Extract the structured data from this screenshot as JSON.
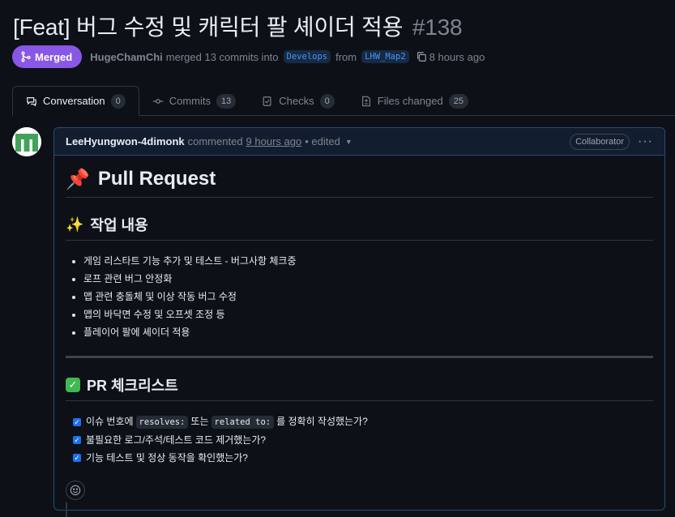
{
  "pr": {
    "title": "[Feat] 버그 수정 및 캐릭터 팔 셰이더 적용",
    "number": "#138",
    "status_label": "Merged",
    "author": "HugeChamChi",
    "merged_text": "merged 13 commits into",
    "base_branch": "Develops",
    "from_text": "from",
    "head_branch": "LHW_Map2",
    "time": "8 hours ago"
  },
  "tabs": [
    {
      "label": "Conversation",
      "count": "0",
      "icon": "conversation-icon"
    },
    {
      "label": "Commits",
      "count": "13",
      "icon": "commit-icon"
    },
    {
      "label": "Checks",
      "count": "0",
      "icon": "checks-icon"
    },
    {
      "label": "Files changed",
      "count": "25",
      "icon": "file-diff-icon"
    }
  ],
  "comment": {
    "author": "LeeHyungwon-4dimonk",
    "action": "commented",
    "time": "9 hours ago",
    "edited": "• edited",
    "role_badge": "Collaborator",
    "h1_emoji": "📌",
    "h1": "Pull Request",
    "work_emoji": "✨",
    "work_title": "작업 내용",
    "work_items": [
      "게임 리스타트 기능 추가 및 테스트 - 버그사항 체크중",
      "로프 관련 버그 안정화",
      "맵 관련 충돌체 및 이상 작동 버그 수정",
      "맵의 바닥면 수정 및 오프셋 조정 등",
      "플레이어 팔에 셰이더 적용"
    ],
    "check_emoji": "✅",
    "check_title": "PR 체크리스트",
    "check_item1_a": "이슈 번호에",
    "check_item1_code1": "resolves:",
    "check_item1_b": "또는",
    "check_item1_code2": "related to:",
    "check_item1_c": "를 정확히 작성했는가?",
    "check_item2": "불필요한 로그/주석/테스트 코드 제거했는가?",
    "check_item3": "기능 테스트 및 정상 동작을 확인했는가?"
  },
  "colors": {
    "merged": "#8957e5",
    "accent": "#4493f8",
    "background": "#0d1117"
  }
}
